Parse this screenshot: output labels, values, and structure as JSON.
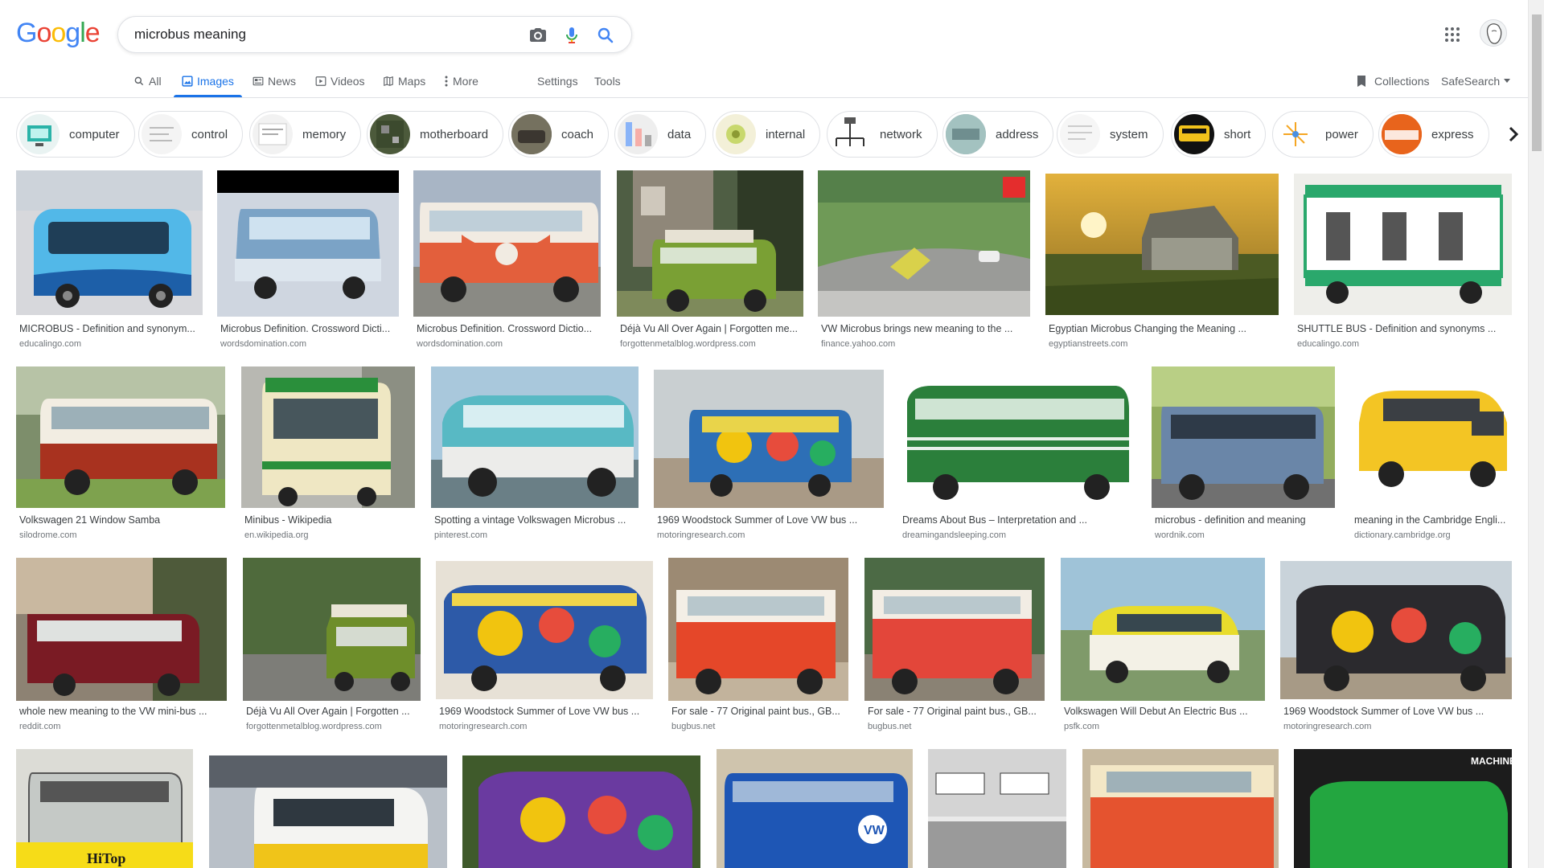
{
  "search": {
    "query": "microbus meaning"
  },
  "nav": {
    "all": "All",
    "images": "Images",
    "news": "News",
    "videos": "Videos",
    "maps": "Maps",
    "more": "More",
    "settings": "Settings",
    "tools": "Tools",
    "collections": "Collections",
    "safesearch": "SafeSearch"
  },
  "chips": [
    "computer",
    "control",
    "memory",
    "motherboard",
    "coach",
    "data",
    "internal",
    "network",
    "address",
    "system",
    "short",
    "power",
    "express"
  ],
  "results": [
    {
      "title": "MICROBUS - Definition and synonym...",
      "source": "educalingo.com"
    },
    {
      "title": "Microbus Definition. Crossword Dicti...",
      "source": "wordsdomination.com"
    },
    {
      "title": "Microbus Definition. Crossword Dictio...",
      "source": "wordsdomination.com"
    },
    {
      "title": "Déjà Vu All Over Again | Forgotten me...",
      "source": "forgottenmetalblog.wordpress.com"
    },
    {
      "title": "VW Microbus brings new meaning to the ...",
      "source": "finance.yahoo.com"
    },
    {
      "title": "Egyptian Microbus Changing the Meaning ...",
      "source": "egyptianstreets.com"
    },
    {
      "title": "SHUTTLE BUS - Definition and synonyms ...",
      "source": "educalingo.com"
    },
    {
      "title": "Volkswagen 21 Window Samba",
      "source": "silodrome.com"
    },
    {
      "title": "Minibus - Wikipedia",
      "source": "en.wikipedia.org"
    },
    {
      "title": "Spotting a vintage Volkswagen Microbus ...",
      "source": "pinterest.com"
    },
    {
      "title": "1969 Woodstock Summer of Love VW bus ...",
      "source": "motoringresearch.com"
    },
    {
      "title": "Dreams About Bus – Interpretation and ...",
      "source": "dreamingandsleeping.com"
    },
    {
      "title": "microbus - definition and meaning",
      "source": "wordnik.com"
    },
    {
      "title": "meaning in the Cambridge Engli...",
      "source": "dictionary.cambridge.org"
    },
    {
      "title": "whole new meaning to the VW mini-bus ...",
      "source": "reddit.com"
    },
    {
      "title": "Déjà Vu All Over Again | Forgotten ...",
      "source": "forgottenmetalblog.wordpress.com"
    },
    {
      "title": "1969 Woodstock Summer of Love VW bus ...",
      "source": "motoringresearch.com"
    },
    {
      "title": "For sale - 77 Original paint bus., GB...",
      "source": "bugbus.net"
    },
    {
      "title": "For sale - 77 Original paint bus., GB...",
      "source": "bugbus.net"
    },
    {
      "title": "Volkswagen Will Debut An Electric Bus ...",
      "source": "psfk.com"
    },
    {
      "title": "1969 Woodstock Summer of Love VW bus ...",
      "source": "motoringresearch.com"
    }
  ],
  "image_text": {
    "hitop": "HiTop",
    "machine": "MACHINE"
  },
  "colors": {
    "accent": "#1a73e8",
    "text_secondary": "#70757a"
  }
}
